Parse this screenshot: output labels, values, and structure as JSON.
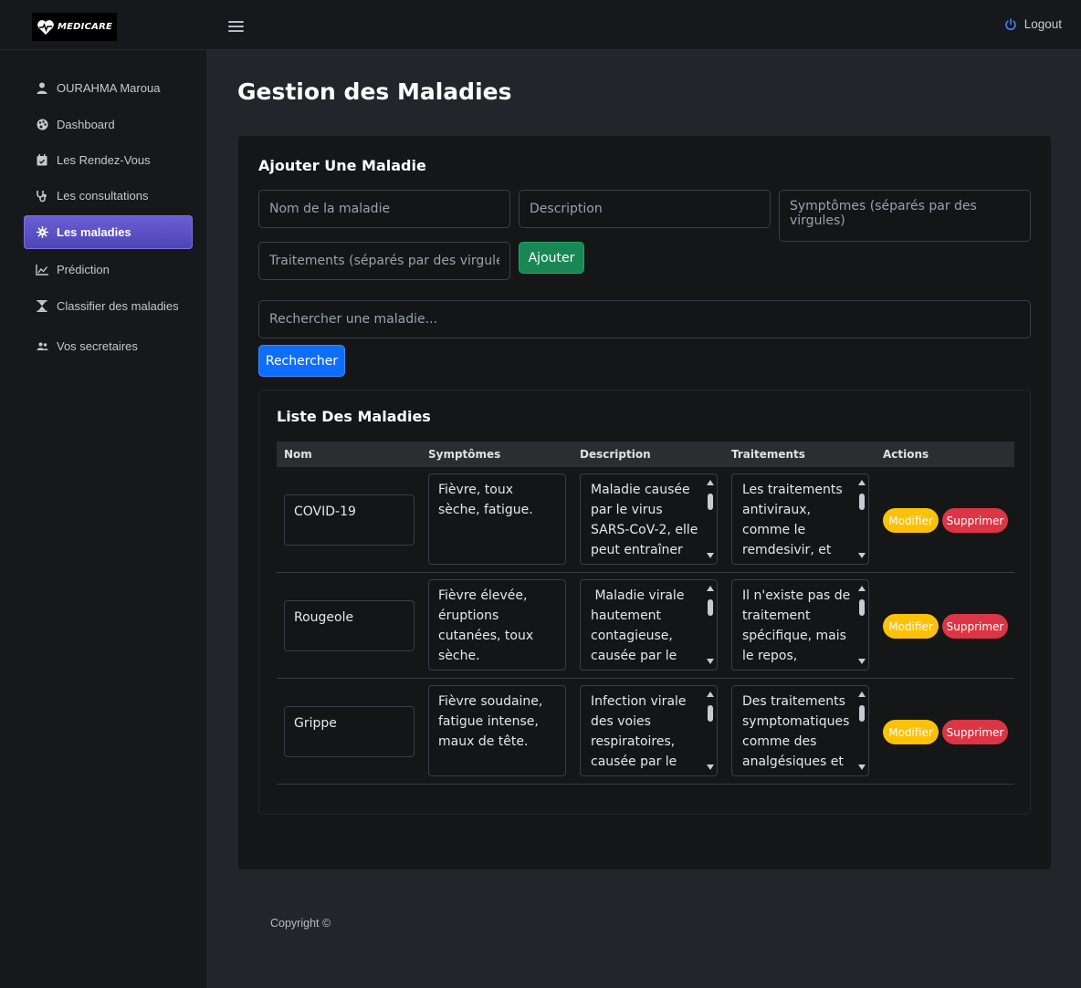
{
  "brand": {
    "name": "MEDICARE",
    "accent": "#6a5fd4"
  },
  "header": {
    "menu_icon": "hamburger-icon",
    "logout_label": "Logout",
    "logout_icon": "power-icon"
  },
  "sidebar": {
    "items": [
      {
        "label": "OURAHMA Maroua",
        "icon": "user-icon"
      },
      {
        "label": "Dashboard",
        "icon": "palette-icon"
      },
      {
        "label": "Les Rendez-Vous",
        "icon": "calendar-check-icon"
      },
      {
        "label": "Les consultations",
        "icon": "stethoscope-icon"
      },
      {
        "label": "Les maladies",
        "icon": "virus-icon",
        "active": true
      },
      {
        "label": "Prédiction",
        "icon": "line-chart-icon"
      },
      {
        "label": "Classifier des maladies",
        "icon": "hourglass-icon"
      },
      {
        "label": "Vos secretaires",
        "icon": "users-icon"
      }
    ]
  },
  "main": {
    "title": "Gestion des Maladies",
    "form": {
      "title": "Ajouter Une Maladie",
      "name_placeholder": "Nom de la maladie",
      "description_placeholder": "Description",
      "symptoms_placeholder": "Symptômes (séparés par des virgules)",
      "treatments_placeholder": "Traitements (séparés par des virgules)",
      "submit_label": "Ajouter"
    },
    "search": {
      "placeholder": "Rechercher une maladie...",
      "button_label": "Rechercher"
    },
    "list": {
      "title": "Liste Des Maladies",
      "columns": [
        "Nom",
        "Symptômes",
        "Description",
        "Traitements",
        "Actions"
      ],
      "rows": [
        {
          "name": "COVID-19",
          "symptoms": "Fièvre, toux sèche, fatigue.",
          "description": "Maladie causée par le virus SARS-CoV-2, elle peut entraîner des",
          "treatments": "Les traitements antiviraux, comme le remdesivir, et des"
        },
        {
          "name": "Rougeole",
          "symptoms": "Fièvre élevée, éruptions cutanées, toux sèche.",
          "description": " Maladie virale hautement contagieuse, causée par le",
          "treatments": "Il n'existe pas de traitement spécifique, mais le repos,"
        },
        {
          "name": "Grippe",
          "symptoms": "Fièvre soudaine, fatigue intense, maux de tête.",
          "description": "Infection virale des voies respiratoires, causée par le",
          "treatments": "Des traitements symptomatiques comme des analgésiques et"
        }
      ],
      "edit_label": "Modifier",
      "delete_label": "Supprimer"
    }
  },
  "footer": {
    "text": "Copyright ©"
  }
}
